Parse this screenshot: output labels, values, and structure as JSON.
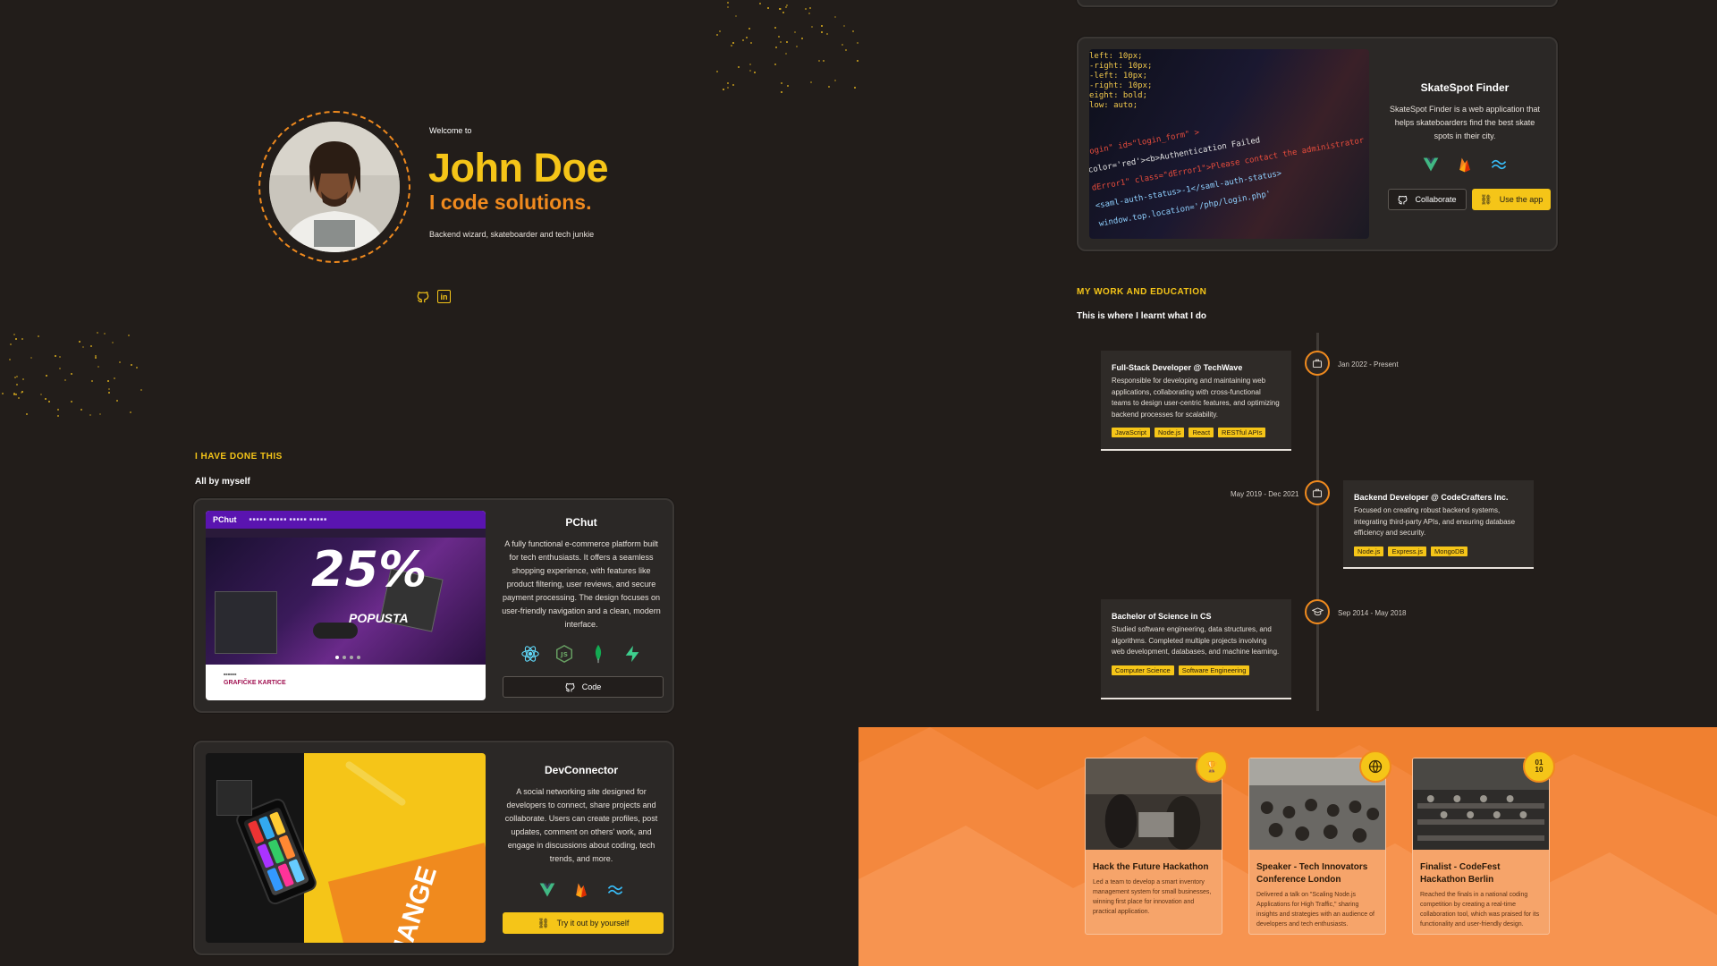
{
  "hero": {
    "welcome": "Welcome to",
    "name": "John Doe",
    "tagline": "I code solutions.",
    "bio": "Backend wizard, skateboarder and tech junkie",
    "social_icons": [
      "github-icon",
      "linkedin-icon"
    ]
  },
  "projects_section": {
    "label": "I HAVE DONE THIS",
    "subtitle": "All by myself"
  },
  "projects": [
    {
      "title": "PChut",
      "description": "A fully functional e-commerce platform built for tech enthusiasts. It offers a seamless shopping experience, with features like product filtering, user reviews, and secure payment processing. The design focuses on user-friendly navigation and a clean, modern interface.",
      "techs": [
        "react-icon",
        "nodejs-icon",
        "mongodb-icon",
        "supabase-icon"
      ],
      "button": "Code",
      "image": {
        "logo": "PChut",
        "banner": "25%",
        "banner_sub": "POPUSTA",
        "section": "GRAFIČKE KARTICE"
      }
    },
    {
      "title": "DevConnector",
      "description": "A social networking site designed for developers to connect, share projects and collaborate. Users can create profiles, post updates, comment on others' work, and engage in discussions about coding, tech trends, and more.",
      "techs": [
        "vue-icon",
        "firebase-icon",
        "tailwind-icon"
      ],
      "button": "Try it out by yourself",
      "image": {
        "book_text": "CHANGE"
      }
    },
    {
      "title": "SkateSpot Finder",
      "description": "SkateSpot Finder is a web application that helps skateboarders find the best skate spots in their city.",
      "techs": [
        "vue-icon",
        "firebase-icon",
        "tailwind-icon"
      ],
      "button_outline": "Collaborate",
      "button_solid": "Use the app",
      "image": {
        "code_lines": [
          "left: 10px;",
          "-right: 10px;",
          "-left: 10px;",
          "-right: 10px;",
          "eight: bold;",
          "low: auto;",
          "login\" id=\"login_form\" >",
          "color='red'><b>Authentication Failed",
          "dError1\" class=\"dError1\">Please contact the administrator",
          "<saml-auth-status>-1</saml-auth-status>",
          "window.top.location='/php/login.php'"
        ]
      }
    }
  ],
  "work_section": {
    "label": "MY WORK AND EDUCATION",
    "subtitle": "This is where I learnt what I do"
  },
  "timeline": [
    {
      "title": "Full-Stack Developer @ TechWave",
      "description": "Responsible for developing and maintaining web applications, collaborating with cross-functional teams to design user-centric features, and optimizing backend processes for scalability.",
      "tags": [
        "JavaScript",
        "Node.js",
        "React",
        "RESTful APIs"
      ],
      "date": "Jan 2022 - Present",
      "icon": "briefcase-icon"
    },
    {
      "title": "Backend Developer @ CodeCrafters Inc.",
      "description": "Focused on creating robust backend systems, integrating third-party APIs, and ensuring database efficiency and security.",
      "tags": [
        "Node.js",
        "Express.js",
        "MongoDB"
      ],
      "date": "May 2019 - Dec 2021",
      "icon": "briefcase-icon"
    },
    {
      "title": "Bachelor of Science in CS",
      "description": "Studied software engineering, data structures, and algorithms. Completed multiple projects involving web development, databases, and machine learning.",
      "tags": [
        "Computer Science",
        "Software Engineering"
      ],
      "date": "Sep 2014 - May 2018",
      "icon": "graduation-cap-icon"
    }
  ],
  "achievements": [
    {
      "title": "Hack the Future Hackathon",
      "description": "Led a team to develop a smart inventory management system for small businesses, winning first place for innovation and practical application.",
      "badge": "trophy-icon"
    },
    {
      "title": "Speaker - Tech Innovators Conference London",
      "description": "Delivered a talk on \"Scaling Node.js Applications for High Traffic,\" sharing insights and strategies with an audience of developers and tech enthusiasts.",
      "badge": "globe-icon"
    },
    {
      "title": "Finalist - CodeFest Hackathon Berlin",
      "description": "Reached the finals in a national coding competition by creating a real-time collaboration tool, which was praised for its functionality and user-friendly design.",
      "badge": "binary-icon"
    }
  ],
  "colors": {
    "background": "#221d1a",
    "accent_yellow": "#f5c518",
    "accent_orange": "#f08a1e",
    "achievements_bg": "#f4883e"
  }
}
